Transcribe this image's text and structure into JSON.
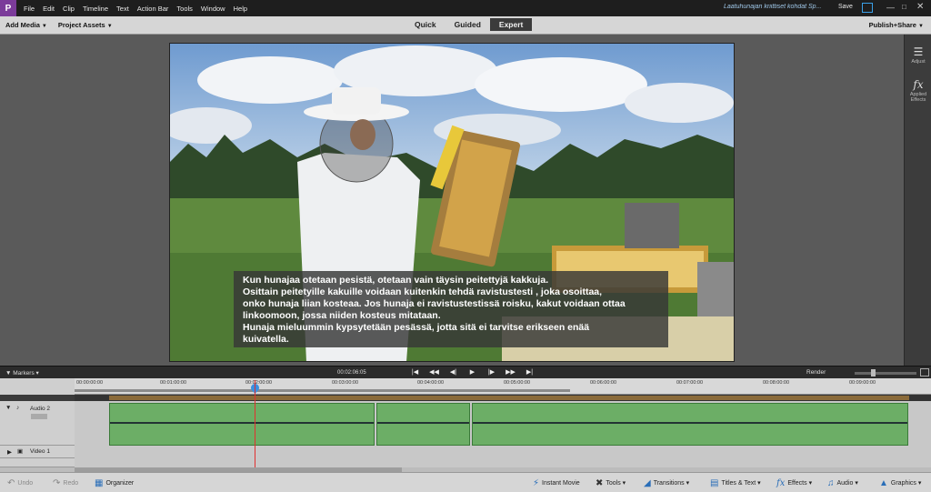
{
  "menubar": {
    "items": [
      "File",
      "Edit",
      "Clip",
      "Timeline",
      "Text",
      "Action Bar",
      "Tools",
      "Window",
      "Help"
    ],
    "doc_title": "Laatuhunajan kriittiset kohdat Sp...",
    "save": "Save"
  },
  "toolbar": {
    "add_media": "Add Media",
    "project_assets": "Project Assets",
    "modes": [
      "Quick",
      "Guided",
      "Expert"
    ],
    "active_mode": "Expert",
    "publish": "Publish+Share"
  },
  "monitor": {
    "subtitles": [
      "Kun hunajaa otetaan pesistä, otetaan vain täysin peitettyjä kakkuja.",
      "Osittain peitetyille kakuille voidaan kuitenkin tehdä ravistustesti , joka osoittaa,",
      "onko hunaja liian kosteaa. Jos hunaja ei ravistustestissä roisku, kakut voidaan ottaa",
      "linkoomoon, jossa niiden kosteus mitataan.",
      "Hunaja mieluummin kypsytetään pesässä, jotta sitä ei tarvitse erikseen enää",
      "kuivatella."
    ]
  },
  "right_panel": {
    "adjust": "Adjust",
    "applied_effects": "Applied Effects"
  },
  "timeline": {
    "markers": "Markers",
    "timecode": "00:02:06:05",
    "render": "Render",
    "ruler": [
      "00:00:00:00",
      "00:01:00:00",
      "00:02:00:00",
      "00:03:00:00",
      "00:04:00:00",
      "00:05:00:00",
      "00:06:00:00",
      "00:07:00:00",
      "00:08:00:00",
      "00:09:00:00"
    ],
    "tracks": {
      "audio": "Audio 2",
      "video": "Video 1"
    }
  },
  "bottom": {
    "undo": "Undo",
    "redo": "Redo",
    "organizer": "Organizer",
    "instant_movie": "Instant Movie",
    "tools": "Tools",
    "transitions": "Transitions",
    "titles_text": "Titles & Text",
    "effects": "Effects",
    "audio": "Audio",
    "graphics": "Graphics"
  }
}
